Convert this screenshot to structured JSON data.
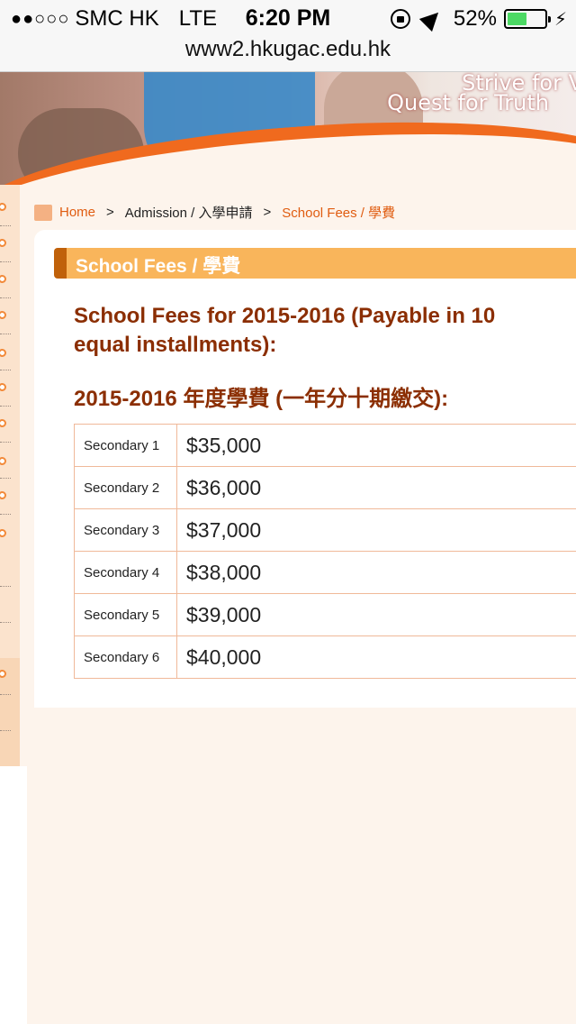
{
  "status_bar": {
    "signal": "●●○○○",
    "carrier": "SMC HK",
    "network": "LTE",
    "time": "6:20 PM",
    "battery_percent": "52%",
    "battery_level": 0.52,
    "icons": [
      "rotation-lock-icon",
      "location-arrow-icon",
      "battery-icon",
      "charging-bolt-icon"
    ]
  },
  "browser": {
    "url": "www2.hkugac.edu.hk"
  },
  "banner": {
    "slogan_line1": "Strive for V",
    "slogan_line2": "Quest for Truth"
  },
  "breadcrumb": {
    "home": "Home",
    "separator": ">",
    "admission": "Admission / 入學申請",
    "current": "School Fees / 學費"
  },
  "page": {
    "title": "School Fees / 學費",
    "heading_en": "School Fees for 2015-2016 (Payable in 10 equal installments):",
    "heading_zh": "2015-2016 年度學費 (一年分十期繳交):"
  },
  "fees": [
    {
      "level": "Secondary 1",
      "amount": "$35,000"
    },
    {
      "level": "Secondary 2",
      "amount": "$36,000"
    },
    {
      "level": "Secondary 3",
      "amount": "$37,000"
    },
    {
      "level": "Secondary 4",
      "amount": "$38,000"
    },
    {
      "level": "Secondary 5",
      "amount": "$39,000"
    },
    {
      "level": "Secondary 6",
      "amount": "$40,000"
    }
  ],
  "colors": {
    "accent_orange": "#e05c10",
    "title_bar": "#f9b55b",
    "heading_brown": "#8b2e02"
  }
}
